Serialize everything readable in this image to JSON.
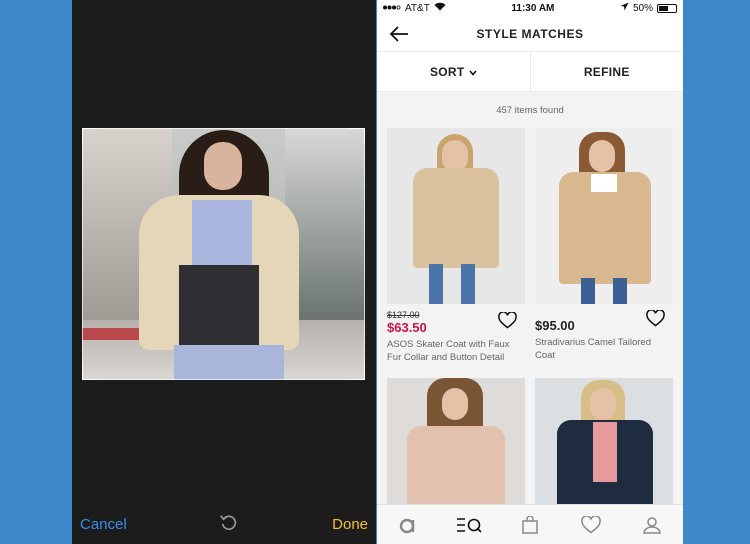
{
  "crop": {
    "cancel_label": "Cancel",
    "done_label": "Done",
    "rotate_icon": "rotate-icon",
    "colors": {
      "cancel": "#3a8fe8",
      "done": "#f5c02c",
      "background": "#1c1c1c"
    }
  },
  "status_bar": {
    "carrier": "AT&T",
    "time": "11:30 AM",
    "battery": "50%"
  },
  "header": {
    "title": "STYLE MATCHES",
    "back_icon": "arrow-left-icon"
  },
  "toolbar": {
    "sort_label": "SORT",
    "refine_label": "REFINE"
  },
  "results": {
    "count_text": "457 items found"
  },
  "products": [
    {
      "old_price": "$127.00",
      "price": "$63.50",
      "on_sale": true,
      "name": "ASOS Skater Coat with Faux Fur Collar and Button Detail"
    },
    {
      "old_price": "",
      "price": "$95.00",
      "on_sale": false,
      "name": "Stradivarius Camel Tailored Coat"
    },
    {
      "old_price": "",
      "price": "",
      "on_sale": false,
      "name": ""
    },
    {
      "old_price": "",
      "price": "",
      "on_sale": false,
      "name": ""
    }
  ],
  "tab_bar": {
    "items": [
      "asos-logo-icon",
      "style-match-icon",
      "bag-icon",
      "heart-icon",
      "account-icon"
    ]
  },
  "colors": {
    "sale_price": "#d01345",
    "page_background": "#3f87cb"
  }
}
